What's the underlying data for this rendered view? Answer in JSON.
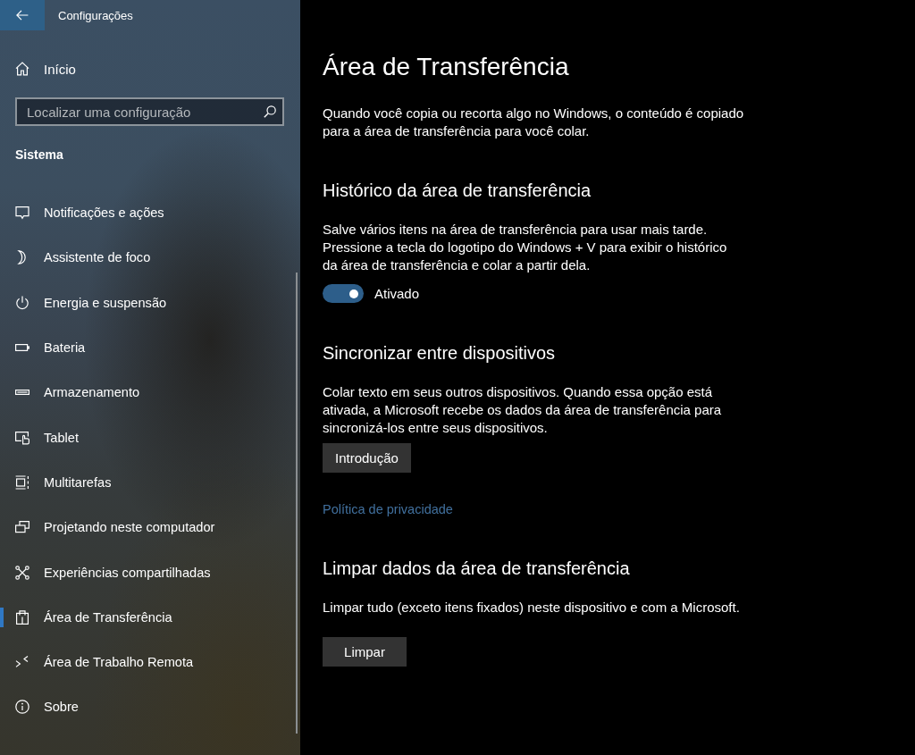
{
  "window": {
    "title": "Configurações"
  },
  "sidebar": {
    "home": "Início",
    "search": {
      "placeholder": "Localizar uma configuração"
    },
    "section": "Sistema",
    "items": [
      {
        "kind": "notifications",
        "label": "Notificações e ações",
        "selected": false
      },
      {
        "kind": "focus",
        "label": "Assistente de foco",
        "selected": false
      },
      {
        "kind": "power",
        "label": "Energia e suspensão",
        "selected": false
      },
      {
        "kind": "battery",
        "label": "Bateria",
        "selected": false
      },
      {
        "kind": "storage",
        "label": "Armazenamento",
        "selected": false
      },
      {
        "kind": "tablet",
        "label": "Tablet",
        "selected": false
      },
      {
        "kind": "multitasking",
        "label": "Multitarefas",
        "selected": false
      },
      {
        "kind": "projecting",
        "label": "Projetando neste computador",
        "selected": false
      },
      {
        "kind": "shared",
        "label": "Experiências compartilhadas",
        "selected": false
      },
      {
        "kind": "clipboard",
        "label": "Área de Transferência",
        "selected": true
      },
      {
        "kind": "remote",
        "label": "Área de Trabalho Remota",
        "selected": false
      },
      {
        "kind": "about",
        "label": "Sobre",
        "selected": false
      }
    ]
  },
  "page": {
    "title": "Área de Transferência",
    "intro": "Quando você copia ou recorta algo no Windows, o conteúdo é copiado para a área de transferência para você colar.",
    "sections": [
      {
        "heading": "Histórico da área de transferência",
        "text": "Salve vários itens na área de transferência para usar mais tarde. Pressione a tecla do logotipo do Windows + V para exibir o histórico da área de transferência e colar a partir dela.",
        "controls": [
          {
            "kind": "toggle",
            "on": true,
            "label": "Ativado"
          }
        ]
      },
      {
        "heading": "Sincronizar entre dispositivos",
        "text": "Colar texto em seus outros dispositivos. Quando essa opção está ativada, a Microsoft recebe os dados da área de transferência para sincronizá-los entre seus dispositivos.",
        "controls": [
          {
            "kind": "button",
            "label": "Introdução"
          },
          {
            "kind": "link",
            "label": "Política de privacidade"
          }
        ]
      },
      {
        "heading": "Limpar dados da área de transferência",
        "text": "Limpar tudo (exceto itens fixados) neste dispositivo e com a Microsoft.",
        "controls": [
          {
            "kind": "button",
            "label": "Limpar"
          }
        ]
      }
    ]
  }
}
